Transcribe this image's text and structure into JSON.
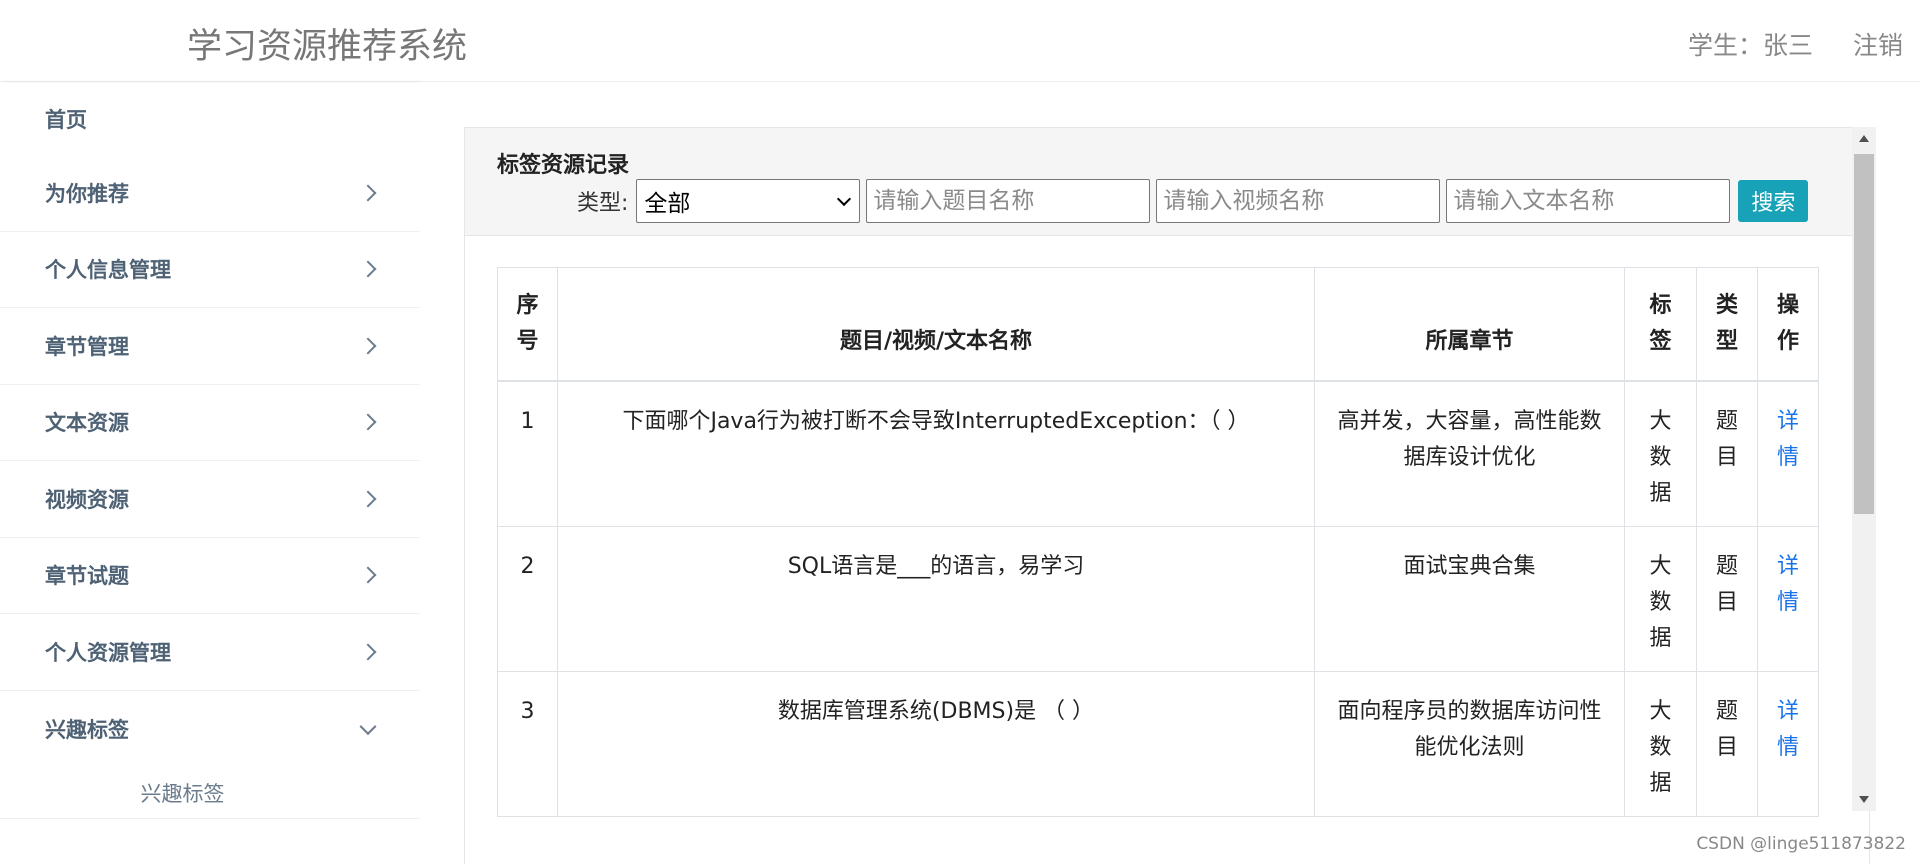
{
  "header": {
    "app_title": "学习资源推荐系统",
    "user_label": "学生：张三",
    "logout_label": "注销"
  },
  "sidebar": {
    "items": [
      {
        "label": "首页"
      },
      {
        "label": "为你推荐"
      },
      {
        "label": "个人信息管理"
      },
      {
        "label": "章节管理"
      },
      {
        "label": "文本资源"
      },
      {
        "label": "视频资源"
      },
      {
        "label": "章节试题"
      },
      {
        "label": "个人资源管理"
      },
      {
        "label": "兴趣标签"
      }
    ],
    "sub_items": [
      {
        "label": "兴趣标签"
      }
    ]
  },
  "panel": {
    "title": "标签资源记录",
    "filter": {
      "type_label": "类型:",
      "type_selected": "全部",
      "question_placeholder": "请输入题目名称",
      "video_placeholder": "请输入视频名称",
      "text_placeholder": "请输入文本名称",
      "search_label": "搜索"
    }
  },
  "table": {
    "headers": [
      "序号",
      "题目/视频/文本名称",
      "所属章节",
      "标签",
      "类型",
      "操作"
    ],
    "rows": [
      {
        "index": "1",
        "name": "下面哪个Java行为被打断不会导致InterruptedException：（ ）",
        "chapter": "高并发，大容量，高性能数据库设计优化",
        "tag": "大数据",
        "type": "题目",
        "action": "详情"
      },
      {
        "index": "2",
        "name": "SQL语言是___的语言，易学习",
        "chapter": "面试宝典合集",
        "tag": "大数据",
        "type": "题目",
        "action": "详情"
      },
      {
        "index": "3",
        "name": "数据库管理系统(DBMS)是 （ ）",
        "chapter": "面向程序员的数据库访问性能优化法则",
        "tag": "大数据",
        "type": "题目",
        "action": "详情"
      }
    ]
  },
  "watermark": "CSDN @linge511873822"
}
